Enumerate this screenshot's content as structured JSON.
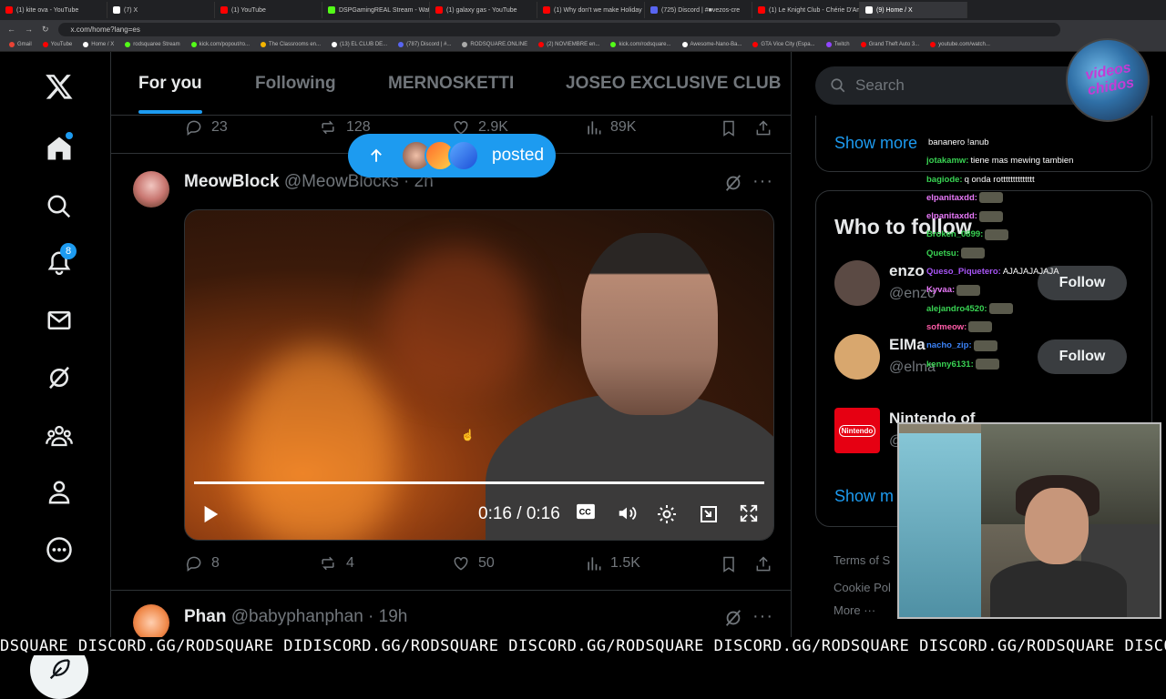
{
  "browser": {
    "tabs": [
      {
        "label": "(1) kite ova - YouTube",
        "color": "#ff0000"
      },
      {
        "label": "(7) X",
        "color": "#ffffff"
      },
      {
        "label": "(1) YouTube",
        "color": "#ff0000"
      },
      {
        "label": "DSPGamingREAL Stream - Wat",
        "color": "#53fc18"
      },
      {
        "label": "(1) galaxy gas - YouTube",
        "color": "#ff0000"
      },
      {
        "label": "(1) Why don't we make Holiday",
        "color": "#ff0000"
      },
      {
        "label": "(725) Discord | #■vezos-cre",
        "color": "#5865f2"
      },
      {
        "label": "(1) Le Knight Club - Chérie D'Am",
        "color": "#ff0000"
      },
      {
        "label": "(9) Home / X",
        "color": "#ffffff",
        "active": true
      }
    ],
    "url": "x.com/home?lang=es",
    "bookmarks": [
      {
        "label": "Gmail",
        "color": "#ea4335"
      },
      {
        "label": "YouTube",
        "color": "#ff0000"
      },
      {
        "label": "Home / X",
        "color": "#ffffff"
      },
      {
        "label": "rodsquaree Stream",
        "color": "#53fc18"
      },
      {
        "label": "kick.com/popout/ro...",
        "color": "#53fc18"
      },
      {
        "label": "The Classrooms en...",
        "color": "#f4b400"
      },
      {
        "label": "(13) EL CLUB DE...",
        "color": "#ffffff"
      },
      {
        "label": "(787) Discord | #...",
        "color": "#5865f2"
      },
      {
        "label": "RODSQUARE.ONLINE",
        "color": "#aaaaaa"
      },
      {
        "label": "(2) NOVIEMBRE en...",
        "color": "#ff0000"
      },
      {
        "label": "kick.com/rodsquare...",
        "color": "#53fc18"
      },
      {
        "label": "Awesome-Nano-Ba...",
        "color": "#ffffff"
      },
      {
        "label": "GTA Vice City (Espa...",
        "color": "#ff0000"
      },
      {
        "label": "Twitch",
        "color": "#9146ff"
      },
      {
        "label": "Grand Theft Auto 3...",
        "color": "#ff0000"
      },
      {
        "label": "youtube.com/watch...",
        "color": "#ff0000"
      }
    ]
  },
  "sidebar": {
    "notification_count": "8"
  },
  "home_tabs": [
    "For you",
    "Following",
    "MERNOSKETTI",
    "JOSEO EXCLUSIVE CLUB"
  ],
  "prev_tweet_actions": {
    "replies": "23",
    "reposts": "128",
    "likes": "2.9K",
    "views": "89K"
  },
  "posted_pill": {
    "label": "posted"
  },
  "tweet": {
    "name": "MeowBlock",
    "handle": "@MeowBlocks",
    "time": "· 2h",
    "video_time": "0:16 / 0:16",
    "video_progress": 1.0,
    "actions": {
      "replies": "8",
      "reposts": "4",
      "likes": "50",
      "views": "1.5K"
    }
  },
  "next_tweet": {
    "name": "Phan",
    "handle": "@babyphanphan",
    "time": "· 19h"
  },
  "right": {
    "search_placeholder": "Search",
    "show_more_top": "Show more",
    "who_to_follow_title": "Who to follow",
    "suggestions": [
      {
        "name": "enzo",
        "handle": "@enzo",
        "follow": "Follow",
        "avatar_color": "#5b4a44"
      },
      {
        "name": "ElMa",
        "handle": "@elma",
        "follow": "Follow",
        "avatar_color": "#d8a76e"
      },
      {
        "name": "Nintendo of",
        "handle": "@",
        "follow": "",
        "avatar_color": "#e60012"
      }
    ],
    "nintendo_logo": "Nintendo",
    "show_more_bottom": "Show m",
    "footer_line1": "Terms of S",
    "footer_line2": "Cookie Pol",
    "footer_line3": "More ···"
  },
  "stream_overlay": {
    "logo_text": "videos chidos",
    "chat": [
      {
        "user": "",
        "msg": "bananero !anub",
        "color": "#ffffff"
      },
      {
        "user": "jotakamw:",
        "msg": "tiene mas mewing tambien",
        "color": "#39d353"
      },
      {
        "user": "bagiode:",
        "msg": "q onda rotttttttttttttt",
        "color": "#39d353"
      },
      {
        "user": "elpanitaxdd:",
        "msg": "",
        "color": "#e879f9"
      },
      {
        "user": "elpanitaxdd:",
        "msg": "",
        "color": "#e879f9"
      },
      {
        "user": "Broken_0899:",
        "msg": "",
        "color": "#39d353"
      },
      {
        "user": "Quetsu:",
        "msg": "",
        "color": "#39d353"
      },
      {
        "user": "Queso_Piquetero:",
        "msg": "AJAJAJAJAJA",
        "color": "#a855f7"
      },
      {
        "user": "Kyvaa:",
        "msg": "",
        "color": "#e879f9"
      },
      {
        "user": "alejandro4520:",
        "msg": "",
        "color": "#39d353"
      },
      {
        "user": "sofmeow:",
        "msg": "",
        "color": "#ff5ca8"
      },
      {
        "user": "nacho_zip:",
        "msg": "",
        "color": "#3b82f6"
      },
      {
        "user": "kenny6131:",
        "msg": "",
        "color": "#39d353"
      }
    ],
    "ticker": "DSQUARE DISCORD.GG/RODSQUARE DIDISCORD.GG/RODSQUARE DISCORD.GG/RODSQUARE DISCORD.GG/RODSQUARE DISCORD.GG/RODSQUARE DISCORD.GG/RO"
  }
}
